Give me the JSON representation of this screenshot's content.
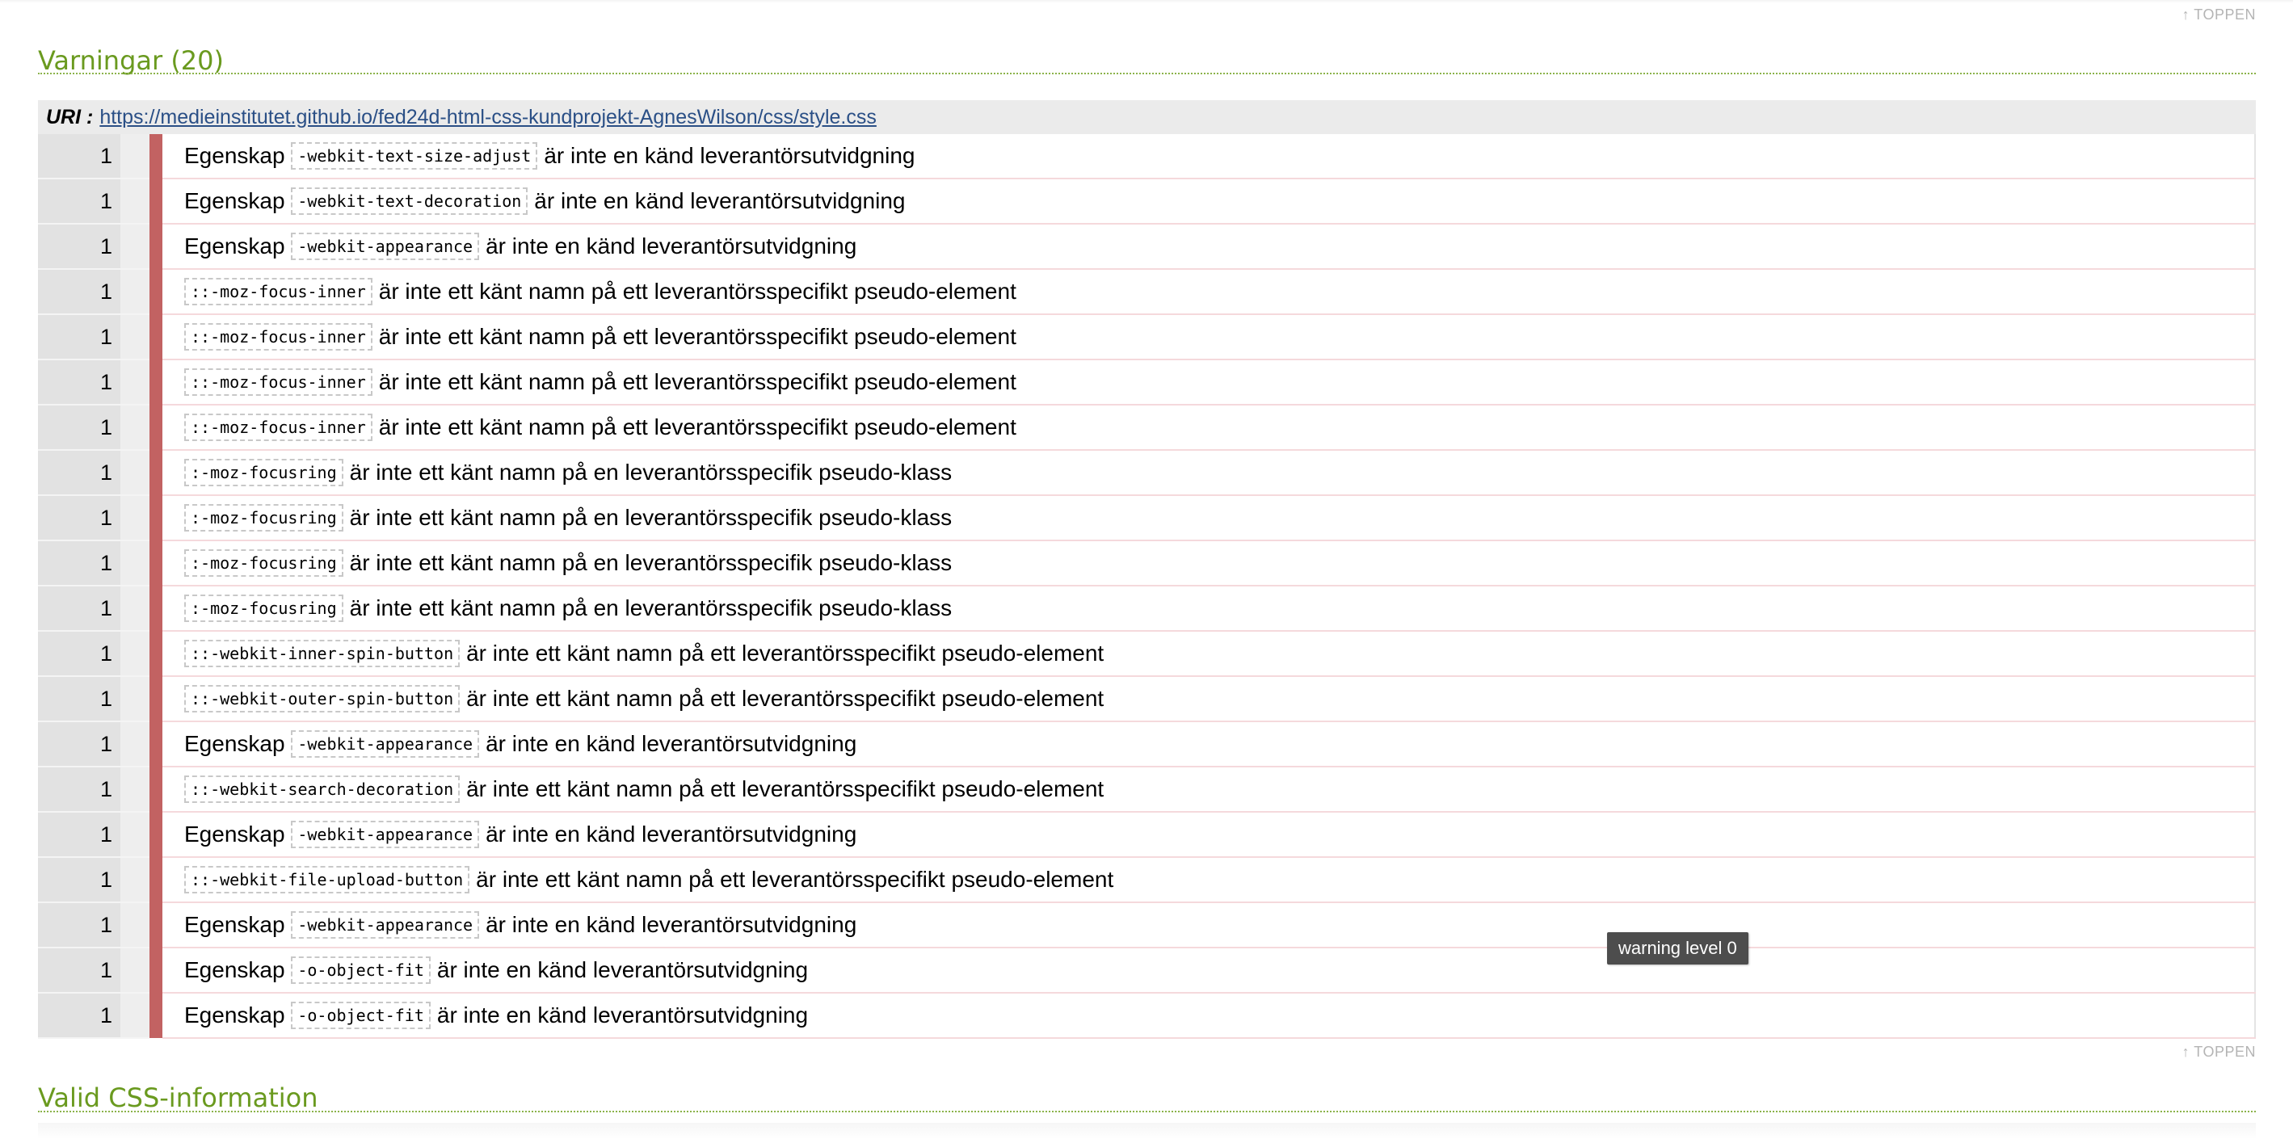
{
  "top_link": "↑ TOPPEN",
  "warnings_section": {
    "title": "Varningar (20)",
    "uri_label": "URI :",
    "uri": "https://medieinstitutet.github.io/fed24d-html-css-kundprojekt-AgnesWilson/css/style.css",
    "rows": [
      {
        "line": "1",
        "pre": "Egenskap",
        "token": "-webkit-text-size-adjust",
        "post": "är inte en känd leverantörsutvidgning"
      },
      {
        "line": "1",
        "pre": "Egenskap",
        "token": "-webkit-text-decoration",
        "post": "är inte en känd leverantörsutvidgning"
      },
      {
        "line": "1",
        "pre": "Egenskap",
        "token": "-webkit-appearance",
        "post": "är inte en känd leverantörsutvidgning"
      },
      {
        "line": "1",
        "pre": "",
        "token": "::-moz-focus-inner",
        "post": "är inte ett känt namn på ett leverantörsspecifikt pseudo-element"
      },
      {
        "line": "1",
        "pre": "",
        "token": "::-moz-focus-inner",
        "post": "är inte ett känt namn på ett leverantörsspecifikt pseudo-element"
      },
      {
        "line": "1",
        "pre": "",
        "token": "::-moz-focus-inner",
        "post": "är inte ett känt namn på ett leverantörsspecifikt pseudo-element"
      },
      {
        "line": "1",
        "pre": "",
        "token": "::-moz-focus-inner",
        "post": "är inte ett känt namn på ett leverantörsspecifikt pseudo-element"
      },
      {
        "line": "1",
        "pre": "",
        "token": ":-moz-focusring",
        "post": "är inte ett känt namn på en leverantörsspecifik pseudo-klass"
      },
      {
        "line": "1",
        "pre": "",
        "token": ":-moz-focusring",
        "post": "är inte ett känt namn på en leverantörsspecifik pseudo-klass"
      },
      {
        "line": "1",
        "pre": "",
        "token": ":-moz-focusring",
        "post": "är inte ett känt namn på en leverantörsspecifik pseudo-klass"
      },
      {
        "line": "1",
        "pre": "",
        "token": ":-moz-focusring",
        "post": "är inte ett känt namn på en leverantörsspecifik pseudo-klass"
      },
      {
        "line": "1",
        "pre": "",
        "token": "::-webkit-inner-spin-button",
        "post": "är inte ett känt namn på ett leverantörsspecifikt pseudo-element"
      },
      {
        "line": "1",
        "pre": "",
        "token": "::-webkit-outer-spin-button",
        "post": "är inte ett känt namn på ett leverantörsspecifikt pseudo-element"
      },
      {
        "line": "1",
        "pre": "Egenskap",
        "token": "-webkit-appearance",
        "post": "är inte en känd leverantörsutvidgning"
      },
      {
        "line": "1",
        "pre": "",
        "token": "::-webkit-search-decoration",
        "post": "är inte ett känt namn på ett leverantörsspecifikt pseudo-element"
      },
      {
        "line": "1",
        "pre": "Egenskap",
        "token": "-webkit-appearance",
        "post": "är inte en känd leverantörsutvidgning"
      },
      {
        "line": "1",
        "pre": "",
        "token": "::-webkit-file-upload-button",
        "post": "är inte ett känt namn på ett leverantörsspecifikt pseudo-element"
      },
      {
        "line": "1",
        "pre": "Egenskap",
        "token": "-webkit-appearance",
        "post": "är inte en känd leverantörsutvidgning"
      },
      {
        "line": "1",
        "pre": "Egenskap",
        "token": "-o-object-fit",
        "post": "är inte en känd leverantörsutvidgning"
      },
      {
        "line": "1",
        "pre": "Egenskap",
        "token": "-o-object-fit",
        "post": "är inte en känd leverantörsutvidgning"
      }
    ]
  },
  "tooltip": "warning level 0",
  "valid_section": {
    "title": "Valid CSS-information"
  },
  "colors": {
    "heading": "#6a9a1f",
    "level_bar": "#c26262",
    "link": "#2a4f86"
  }
}
